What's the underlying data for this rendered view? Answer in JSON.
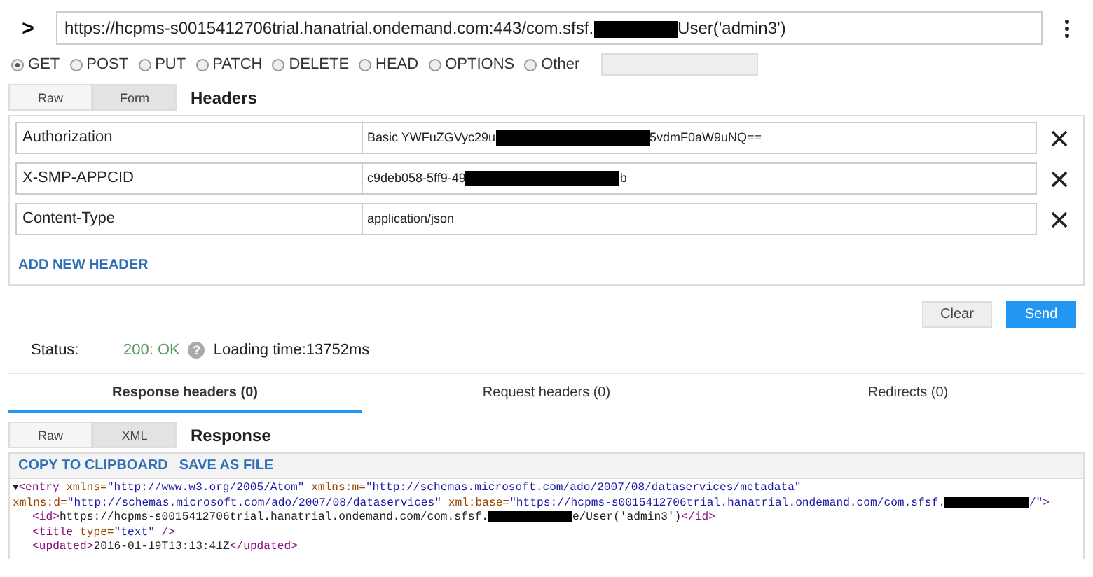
{
  "url_bar": {
    "expand_glyph": ">",
    "segments": [
      {
        "kind": "text",
        "text": "https://hcpms-s0015412706trial.hanatrial.ondemand.com:443/com.sfsf."
      },
      {
        "kind": "redaction"
      },
      {
        "kind": "text",
        "text": "User('admin3')"
      }
    ]
  },
  "methods": [
    {
      "label": "GET",
      "selected": true
    },
    {
      "label": "POST",
      "selected": false
    },
    {
      "label": "PUT",
      "selected": false
    },
    {
      "label": "PATCH",
      "selected": false
    },
    {
      "label": "DELETE",
      "selected": false
    },
    {
      "label": "HEAD",
      "selected": false
    },
    {
      "label": "OPTIONS",
      "selected": false
    },
    {
      "label": "Other",
      "selected": false
    }
  ],
  "header_tabs": {
    "tabs": [
      {
        "label": "Raw",
        "selected": false
      },
      {
        "label": "Form",
        "selected": true
      }
    ],
    "title": "Headers"
  },
  "headers": [
    {
      "name": "Authorization",
      "value": [
        {
          "kind": "text",
          "text": "Basic YWFuZGVyc29u"
        },
        {
          "kind": "redaction"
        },
        {
          "kind": "text",
          "text": "5vdmF0aW9uNQ=="
        }
      ]
    },
    {
      "name": "X-SMP-APPCID",
      "value": [
        {
          "kind": "text",
          "text": "c9deb058-5ff9-49"
        },
        {
          "kind": "redaction"
        },
        {
          "kind": "text",
          "text": "b"
        }
      ]
    },
    {
      "name": "Content-Type",
      "value": [
        {
          "kind": "text",
          "text": "application/json"
        }
      ]
    }
  ],
  "add_header": "ADD NEW HEADER",
  "buttons": [
    {
      "label": "Clear",
      "kind": "secondary"
    },
    {
      "label": "Send",
      "kind": "primary"
    }
  ],
  "status": {
    "label": "Status:",
    "code": "200: OK",
    "help_glyph": "?",
    "loading": "Loading time:13752ms"
  },
  "result_tabs": [
    {
      "label": "Response headers (0)",
      "selected": true
    },
    {
      "label": "Request headers (0)",
      "selected": false
    },
    {
      "label": "Redirects (0)",
      "selected": false
    }
  ],
  "response_tabs": {
    "tabs": [
      {
        "label": "Raw",
        "selected": false
      },
      {
        "label": "XML",
        "selected": true
      }
    ],
    "title": "Response"
  },
  "response_actions": [
    "COPY TO CLIPBOARD",
    "SAVE AS FILE"
  ],
  "code_lines": [
    {
      "toggle": "▼",
      "indent": false,
      "segments": [
        {
          "kind": "tag",
          "text": "<entry "
        },
        {
          "kind": "attr",
          "text": "xmlns="
        },
        {
          "kind": "val",
          "text": "\"http://www.w3.org/2005/Atom\""
        },
        {
          "kind": "attr",
          "text": " xmlns:m="
        },
        {
          "kind": "val",
          "text": "\"http://schemas.microsoft.com/ado/2007/08/dataservices/metadata\""
        }
      ]
    },
    {
      "indent": false,
      "segments": [
        {
          "kind": "attr",
          "text": "xmlns:d="
        },
        {
          "kind": "val",
          "text": "\"http://schemas.microsoft.com/ado/2007/08/dataservices\""
        },
        {
          "kind": "attr",
          "text": " xml:base="
        },
        {
          "kind": "val",
          "text": "\"https://hcpms-s0015412706trial.hanatrial.ondemand.com/com.sfsf."
        },
        {
          "kind": "redaction"
        },
        {
          "kind": "val",
          "text": "/\""
        },
        {
          "kind": "tag",
          "text": ">"
        }
      ]
    },
    {
      "indent": true,
      "segments": [
        {
          "kind": "tag",
          "text": "<id>"
        },
        {
          "kind": "text",
          "text": "https://hcpms-s0015412706trial.hanatrial.ondemand.com/com.sfsf."
        },
        {
          "kind": "redaction"
        },
        {
          "kind": "text",
          "text": "e/User('admin3')"
        },
        {
          "kind": "tag",
          "text": "</id>"
        }
      ]
    },
    {
      "indent": true,
      "segments": [
        {
          "kind": "tag",
          "text": "<title "
        },
        {
          "kind": "attr",
          "text": "type="
        },
        {
          "kind": "val",
          "text": "\"text\""
        },
        {
          "kind": "tag",
          "text": " />"
        }
      ]
    },
    {
      "indent": true,
      "segments": [
        {
          "kind": "tag",
          "text": "<updated>"
        },
        {
          "kind": "text",
          "text": "2016-01-19T13:13:41Z"
        },
        {
          "kind": "tag",
          "text": "</updated>"
        }
      ]
    }
  ]
}
